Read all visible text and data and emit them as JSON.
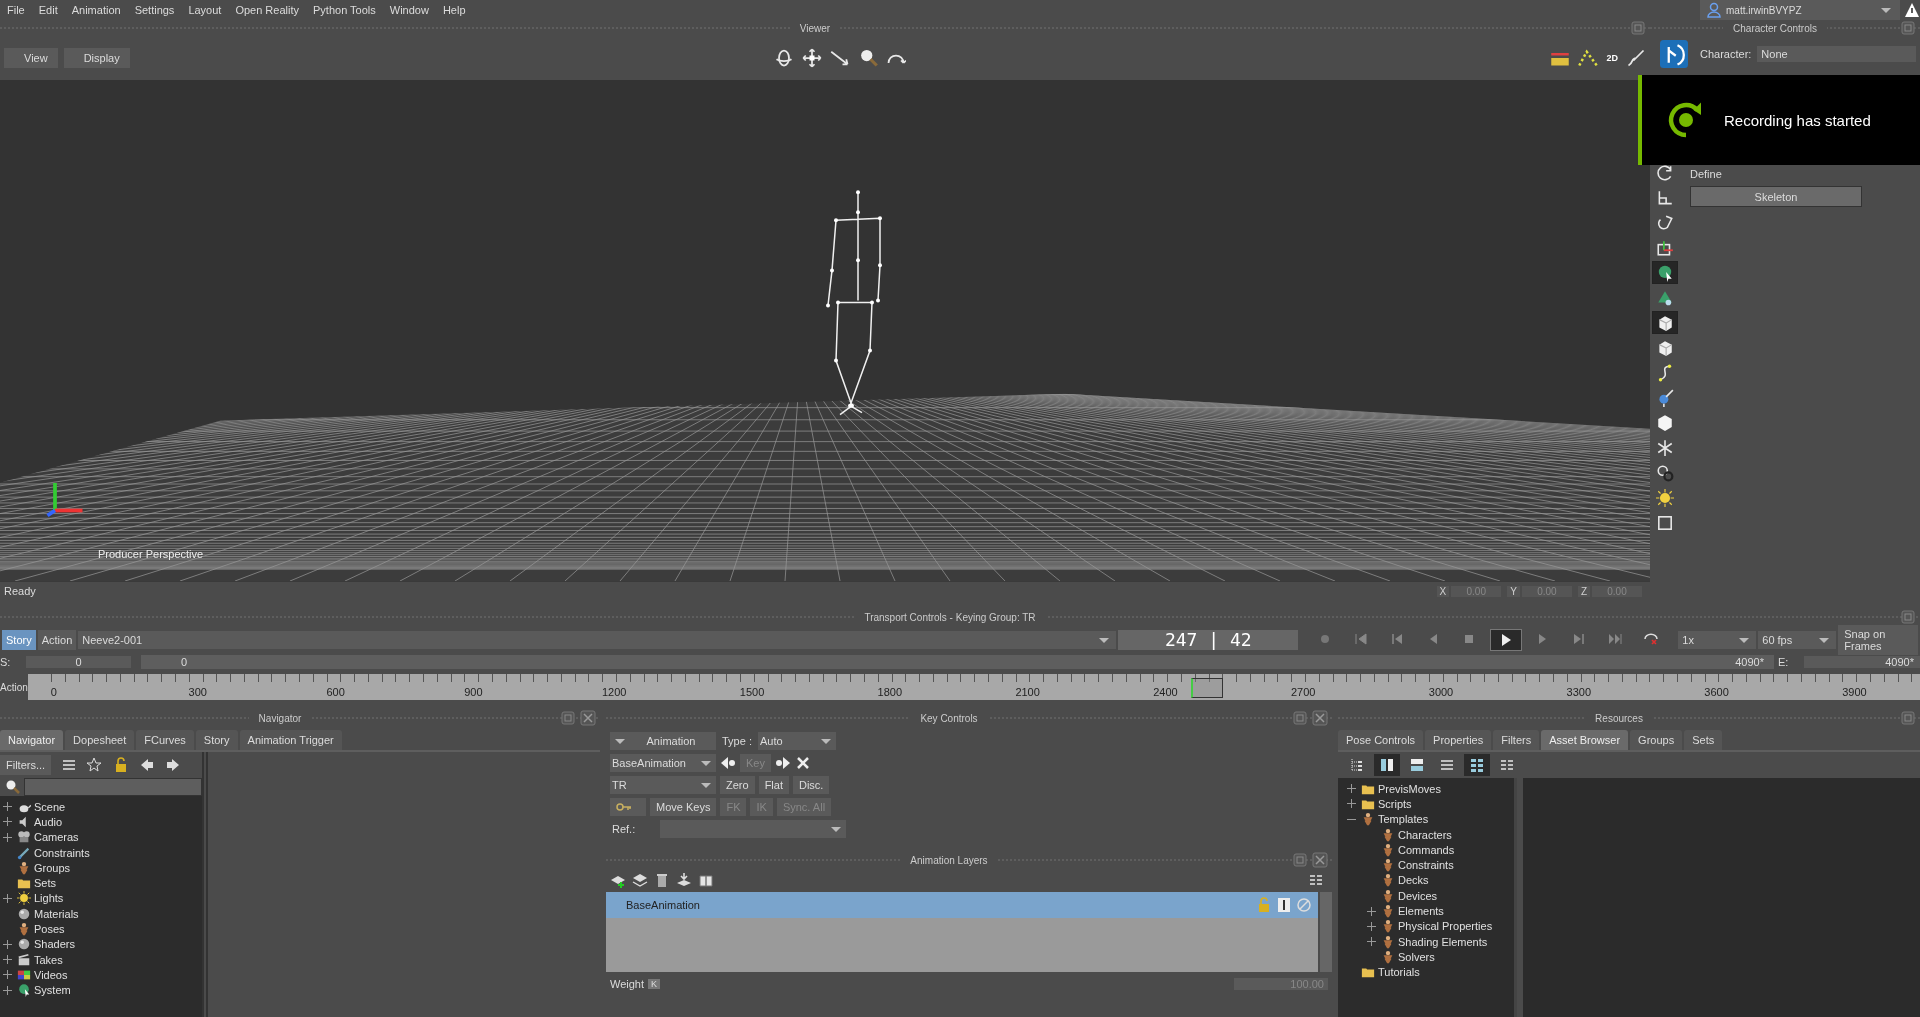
{
  "menu": [
    "File",
    "Edit",
    "Animation",
    "Settings",
    "Layout",
    "Open Reality",
    "Python Tools",
    "Window",
    "Help"
  ],
  "user": {
    "name": "matt.irwinBVYPZ"
  },
  "viewer": {
    "title": "Viewer",
    "menus": [
      "View",
      "Display"
    ],
    "camera_label": "Producer Perspective",
    "nav_tools": [
      {
        "kind": "orbit"
      },
      {
        "kind": "pan"
      },
      {
        "kind": "dolly"
      },
      {
        "kind": "zoom"
      },
      {
        "kind": "roll"
      }
    ],
    "display_tools": [
      {
        "kind": "ruler"
      },
      {
        "kind": "trajectory"
      },
      {
        "kind": "view2d",
        "label": "2D"
      },
      {
        "kind": "pen"
      }
    ]
  },
  "status": {
    "text": "Ready",
    "coords": [
      {
        "axis": "X",
        "value": "0.00"
      },
      {
        "axis": "Y",
        "value": "0.00"
      },
      {
        "axis": "Z",
        "value": "0.00"
      }
    ]
  },
  "character_controls": {
    "title": "Character Controls",
    "character_label": "Character:",
    "character_value": "None",
    "define_label": "Define",
    "skeleton_button": "Skeleton",
    "tools": [
      {
        "kind": "rotate",
        "selected": false
      },
      {
        "kind": "scale",
        "selected": false
      },
      {
        "kind": "magnet",
        "selected": false
      },
      {
        "kind": "axes",
        "selected": false
      },
      {
        "kind": "globe",
        "selected": true
      },
      {
        "kind": "cone",
        "selected": false
      },
      {
        "kind": "cube",
        "selected": true
      },
      {
        "kind": "cube",
        "selected": false
      },
      {
        "kind": "curve",
        "selected": false
      },
      {
        "kind": "pin",
        "selected": false
      },
      {
        "kind": "hexagon",
        "selected": false
      },
      {
        "kind": "asterisk",
        "selected": false
      },
      {
        "kind": "gears",
        "selected": false
      },
      {
        "kind": "sun",
        "selected": false
      },
      {
        "kind": "square",
        "selected": false
      }
    ]
  },
  "notification": {
    "text": "Recording has started"
  },
  "transport": {
    "title": "Transport Controls  -  Keying Group: TR",
    "modes": [
      {
        "label": "Story",
        "selected": true
      },
      {
        "label": "Action",
        "selected": false
      }
    ],
    "clip": "Neeve2-001",
    "time": "247 | 42",
    "buttons": [
      {
        "kind": "record",
        "selected": false
      },
      {
        "kind": "start",
        "selected": false
      },
      {
        "kind": "prevkey",
        "selected": false
      },
      {
        "kind": "prev",
        "selected": false
      },
      {
        "kind": "stop",
        "selected": false
      },
      {
        "kind": "play",
        "selected": true
      },
      {
        "kind": "next",
        "selected": false
      },
      {
        "kind": "nextkey",
        "selected": false
      },
      {
        "kind": "end",
        "selected": false
      },
      {
        "kind": "loop",
        "selected": false
      }
    ],
    "speed": "1x",
    "fps": "60 fps",
    "snap": "Snap on Frames",
    "start_label": "S:",
    "start_value": "0",
    "zoom_start": "0",
    "zoom_end": "4090*",
    "end_label": "E:",
    "end_value": "4090*",
    "ruler_label": "Action",
    "ticks": [
      "0",
      "300",
      "600",
      "900",
      "1200",
      "1500",
      "1800",
      "2100",
      "2400",
      "2700",
      "3000",
      "3300",
      "3600",
      "3900"
    ]
  },
  "navigator": {
    "title": "Navigator",
    "tabs": [
      {
        "label": "Navigator",
        "selected": true
      },
      {
        "label": "Dopesheet",
        "selected": false
      },
      {
        "label": "FCurves",
        "selected": false
      },
      {
        "label": "Story",
        "selected": false
      },
      {
        "label": "Animation Trigger",
        "selected": false
      }
    ],
    "filter_button": "Filters...",
    "tree": [
      {
        "label": "Scene",
        "kind": "teapot",
        "expandable": true,
        "expanded": false
      },
      {
        "label": "Audio",
        "kind": "speaker",
        "expandable": true,
        "expanded": false
      },
      {
        "label": "Cameras",
        "kind": "camera",
        "expandable": true,
        "expanded": false
      },
      {
        "label": "Constraints",
        "kind": "link",
        "expandable": false,
        "expanded": false
      },
      {
        "label": "Groups",
        "kind": "figure",
        "expandable": false,
        "expanded": false
      },
      {
        "label": "Sets",
        "kind": "folder",
        "expandable": false,
        "expanded": false
      },
      {
        "label": "Lights",
        "kind": "sun",
        "expandable": true,
        "expanded": false
      },
      {
        "label": "Materials",
        "kind": "sphere",
        "expandable": false,
        "expanded": false
      },
      {
        "label": "Poses",
        "kind": "figure",
        "expandable": false,
        "expanded": false
      },
      {
        "label": "Shaders",
        "kind": "sphere",
        "expandable": true,
        "expanded": false
      },
      {
        "label": "Takes",
        "kind": "clapper",
        "expandable": true,
        "expanded": false
      },
      {
        "label": "Videos",
        "kind": "film",
        "expandable": true,
        "expanded": false
      },
      {
        "label": "System",
        "kind": "globe",
        "expandable": true,
        "expanded": false
      }
    ]
  },
  "key_controls": {
    "title": "Key Controls",
    "layer_mode": "Animation",
    "type_label": "Type :",
    "type_value": "Auto",
    "layer": "BaseAnimation",
    "key_button": {
      "label": "Key",
      "disabled": true
    },
    "keying_set": "TR",
    "interp": [
      {
        "label": "Zero",
        "disabled": false
      },
      {
        "label": "Flat",
        "disabled": false
      },
      {
        "label": "Disc.",
        "disabled": false
      }
    ],
    "move_keys": "Move Keys",
    "ik_buttons": [
      {
        "label": "FK",
        "disabled": true
      },
      {
        "label": "IK",
        "disabled": true
      },
      {
        "label": "Sync. All",
        "disabled": true
      }
    ],
    "ref_label": "Ref.:"
  },
  "animation_layers": {
    "title": "Animation Layers",
    "layers": [
      {
        "name": "BaseAnimation",
        "selected": true
      }
    ],
    "weight_label": "Weight",
    "weight_key": "K",
    "weight_value": "100.00"
  },
  "resources": {
    "title": "Resources",
    "tabs": [
      {
        "label": "Pose Controls",
        "selected": false
      },
      {
        "label": "Properties",
        "selected": false
      },
      {
        "label": "Filters",
        "selected": false
      },
      {
        "label": "Asset Browser",
        "selected": true
      },
      {
        "label": "Groups",
        "selected": false
      },
      {
        "label": "Sets",
        "selected": false
      }
    ],
    "view_buttons": [
      {
        "kind": "tree",
        "selected": false
      },
      {
        "kind": "splitv",
        "selected": true
      },
      {
        "kind": "splith",
        "selected": false
      },
      {
        "kind": "list",
        "selected": false
      },
      {
        "kind": "grid",
        "selected": true
      },
      {
        "kind": "columns",
        "selected": false
      }
    ],
    "tree": [
      {
        "label": "PrevisMoves",
        "kind": "folder",
        "expandable": true,
        "expanded": false
      },
      {
        "label": "Scripts",
        "kind": "folder",
        "expandable": true,
        "expanded": false
      },
      {
        "label": "Templates",
        "kind": "figure",
        "expandable": true,
        "expanded": true,
        "children": [
          {
            "label": "Characters",
            "kind": "figure",
            "expandable": false,
            "expanded": false
          },
          {
            "label": "Commands",
            "kind": "figure",
            "expandable": false,
            "expanded": false
          },
          {
            "label": "Constraints",
            "kind": "figure",
            "expandable": false,
            "expanded": false
          },
          {
            "label": "Decks",
            "kind": "figure",
            "expandable": false,
            "expanded": false
          },
          {
            "label": "Devices",
            "kind": "figure",
            "expandable": false,
            "expanded": false
          },
          {
            "label": "Elements",
            "kind": "figure",
            "expandable": true,
            "expanded": false
          },
          {
            "label": "Physical Properties",
            "kind": "figure",
            "expandable": true,
            "expanded": false
          },
          {
            "label": "Shading Elements",
            "kind": "figure",
            "expandable": true,
            "expanded": false
          },
          {
            "label": "Solvers",
            "kind": "figure",
            "expandable": false,
            "expanded": false
          }
        ]
      },
      {
        "label": "Tutorials",
        "kind": "folder",
        "expandable": false,
        "expanded": false
      }
    ]
  }
}
